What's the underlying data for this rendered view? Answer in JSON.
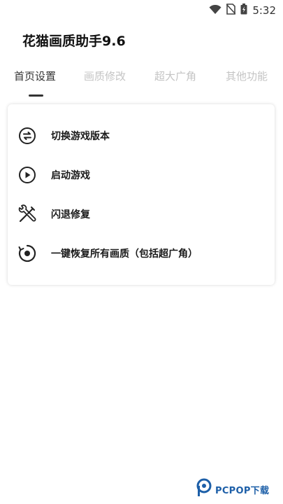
{
  "status_bar": {
    "time": "5:32",
    "icons": [
      "wifi-icon",
      "no-sim-icon",
      "battery-icon"
    ]
  },
  "app": {
    "title": "花猫画质助手9.6"
  },
  "tabs": [
    {
      "label": "首页设置",
      "active": true
    },
    {
      "label": "画质修改",
      "active": false
    },
    {
      "label": "超大广角",
      "active": false
    },
    {
      "label": "其他功能",
      "active": false
    }
  ],
  "menu": {
    "items": [
      {
        "label": "切换游戏版本",
        "icon": "switch-icon"
      },
      {
        "label": "启动游戏",
        "icon": "play-icon"
      },
      {
        "label": "闪退修复",
        "icon": "wrench-screwdriver-icon"
      },
      {
        "label": "一键恢复所有画质（包括超广角）",
        "icon": "restore-icon"
      }
    ]
  },
  "watermark": {
    "text": "PCPOP下载"
  },
  "colors": {
    "accent_text": "#333333",
    "inactive_tab": "#c4c4c4",
    "watermark": "#1d5fa8"
  }
}
